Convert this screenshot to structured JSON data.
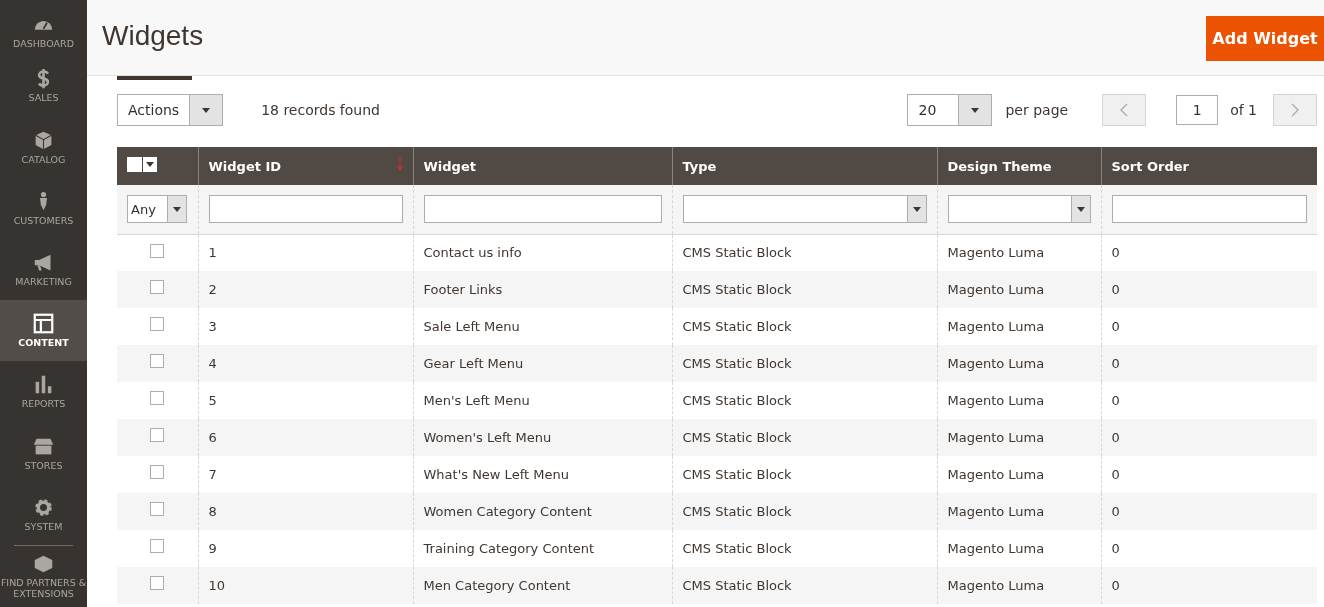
{
  "sidebar": {
    "items": [
      {
        "label": "DASHBOARD",
        "selected": false
      },
      {
        "label": "SALES",
        "selected": false
      },
      {
        "label": "CATALOG",
        "selected": false
      },
      {
        "label": "CUSTOMERS",
        "selected": false
      },
      {
        "label": "MARKETING",
        "selected": false
      },
      {
        "label": "CONTENT",
        "selected": true
      },
      {
        "label": "REPORTS",
        "selected": false
      },
      {
        "label": "STORES",
        "selected": false
      },
      {
        "label": "SYSTEM",
        "selected": false
      },
      {
        "label": "FIND PARTNERS & EXTENSIONS",
        "selected": false
      }
    ]
  },
  "page": {
    "title": "Widgets",
    "primary_button": "Add Widget"
  },
  "toolbar": {
    "actions": "Actions",
    "records": "18 records found",
    "per_page_value": "20",
    "per_page_label": "per page",
    "page": "1",
    "of_pages": "of 1"
  },
  "table": {
    "select_all_checked": false,
    "columns": [
      {
        "label": "Widget ID",
        "sorted": true
      },
      {
        "label": "Widget",
        "sorted": false
      },
      {
        "label": "Type",
        "sorted": false
      },
      {
        "label": "Design Theme",
        "sorted": false
      },
      {
        "label": "Sort Order",
        "sorted": false
      }
    ],
    "filters": [
      {
        "kind": "select",
        "value": "Any"
      },
      {
        "kind": "text"
      },
      {
        "kind": "text"
      },
      {
        "kind": "select"
      },
      {
        "kind": "select"
      },
      {
        "kind": "text"
      }
    ],
    "rows": [
      {
        "checked": false,
        "cells": [
          "1",
          "Contact us info",
          "CMS Static Block",
          "Magento Luma",
          "0"
        ]
      },
      {
        "checked": false,
        "cells": [
          "2",
          "Footer Links",
          "CMS Static Block",
          "Magento Luma",
          "0"
        ]
      },
      {
        "checked": false,
        "cells": [
          "3",
          "Sale Left Menu",
          "CMS Static Block",
          "Magento Luma",
          "0"
        ]
      },
      {
        "checked": false,
        "cells": [
          "4",
          "Gear Left Menu",
          "CMS Static Block",
          "Magento Luma",
          "0"
        ]
      },
      {
        "checked": false,
        "cells": [
          "5",
          "Men's Left Menu",
          "CMS Static Block",
          "Magento Luma",
          "0"
        ]
      },
      {
        "checked": false,
        "cells": [
          "6",
          "Women's Left Menu",
          "CMS Static Block",
          "Magento Luma",
          "0"
        ]
      },
      {
        "checked": false,
        "cells": [
          "7",
          "What's New Left Menu",
          "CMS Static Block",
          "Magento Luma",
          "0"
        ]
      },
      {
        "checked": false,
        "cells": [
          "8",
          "Women Category Content",
          "CMS Static Block",
          "Magento Luma",
          "0"
        ]
      },
      {
        "checked": false,
        "cells": [
          "9",
          "Training Category Content",
          "CMS Static Block",
          "Magento Luma",
          "0"
        ]
      },
      {
        "checked": false,
        "cells": [
          "10",
          "Men Category Content",
          "CMS Static Block",
          "Magento Luma",
          "0"
        ]
      }
    ]
  }
}
